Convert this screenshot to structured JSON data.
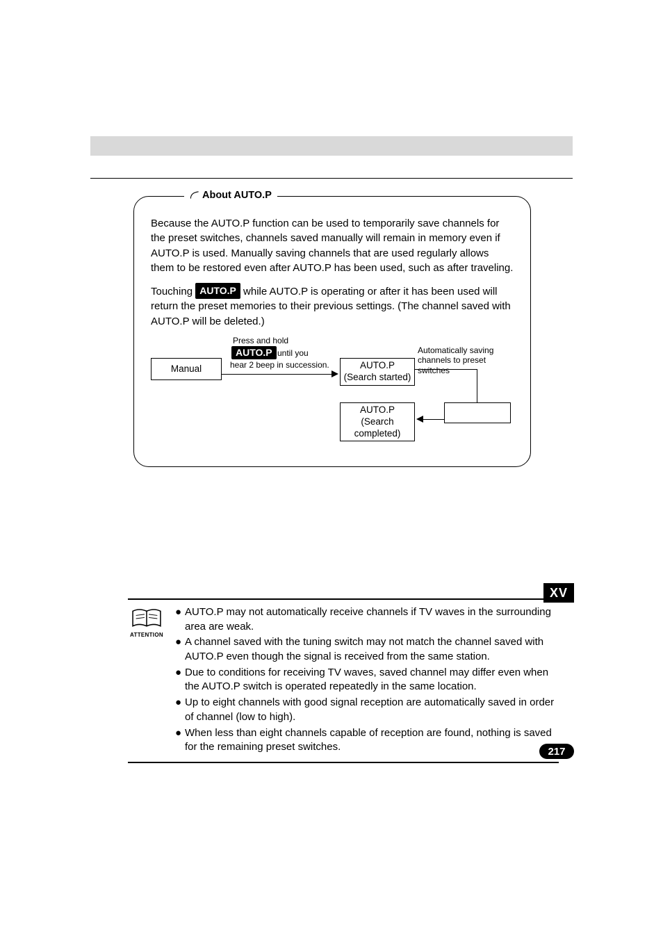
{
  "about": {
    "legend": "About AUTO.P",
    "para1": "Because the AUTO.P function can be used to temporarily save channels for the preset switches, channels saved manually will remain in memory even if AUTO.P is used. Manually saving channels that are used regularly allows them to be restored even after AUTO.P has been used, such as after traveling.",
    "para2_prefix": "Touching ",
    "autop_chip": "AUTO.P",
    "para2_suffix": " while AUTO.P is operating or after it has been used will return the preset memories to their previous settings. (The channel saved with AUTO.P will be deleted.)"
  },
  "diagram": {
    "press_hold": "Press and hold",
    "autop_chip": "AUTO.P",
    "until_you": " until you",
    "hear_beep": "hear 2 beep in succession.",
    "manual": "Manual",
    "search_started_l1": "AUTO.P",
    "search_started_l2": "(Search started)",
    "search_completed_l1": "AUTO.P",
    "search_completed_l2": "(Search",
    "search_completed_l3": "completed)",
    "auto_save_l1": "Automatically saving",
    "auto_save_l2": "channels to preset switches"
  },
  "attention": {
    "label": "ATTENTION",
    "items": [
      "AUTO.P may not automatically receive channels if TV waves in the surrounding area are weak.",
      "A channel saved with the tuning switch may not match the channel saved with AUTO.P even though the signal is received from the same station.",
      "Due to conditions for receiving TV waves, saved channel may differ even when the AUTO.P switch is operated repeatedly in the same location.",
      "Up to eight channels with good signal reception are automatically saved in order of channel (low to high).",
      "When less than eight channels capable of reception are found, nothing is saved for the remaining preset switches."
    ]
  },
  "chapter": "XV",
  "page": "217"
}
